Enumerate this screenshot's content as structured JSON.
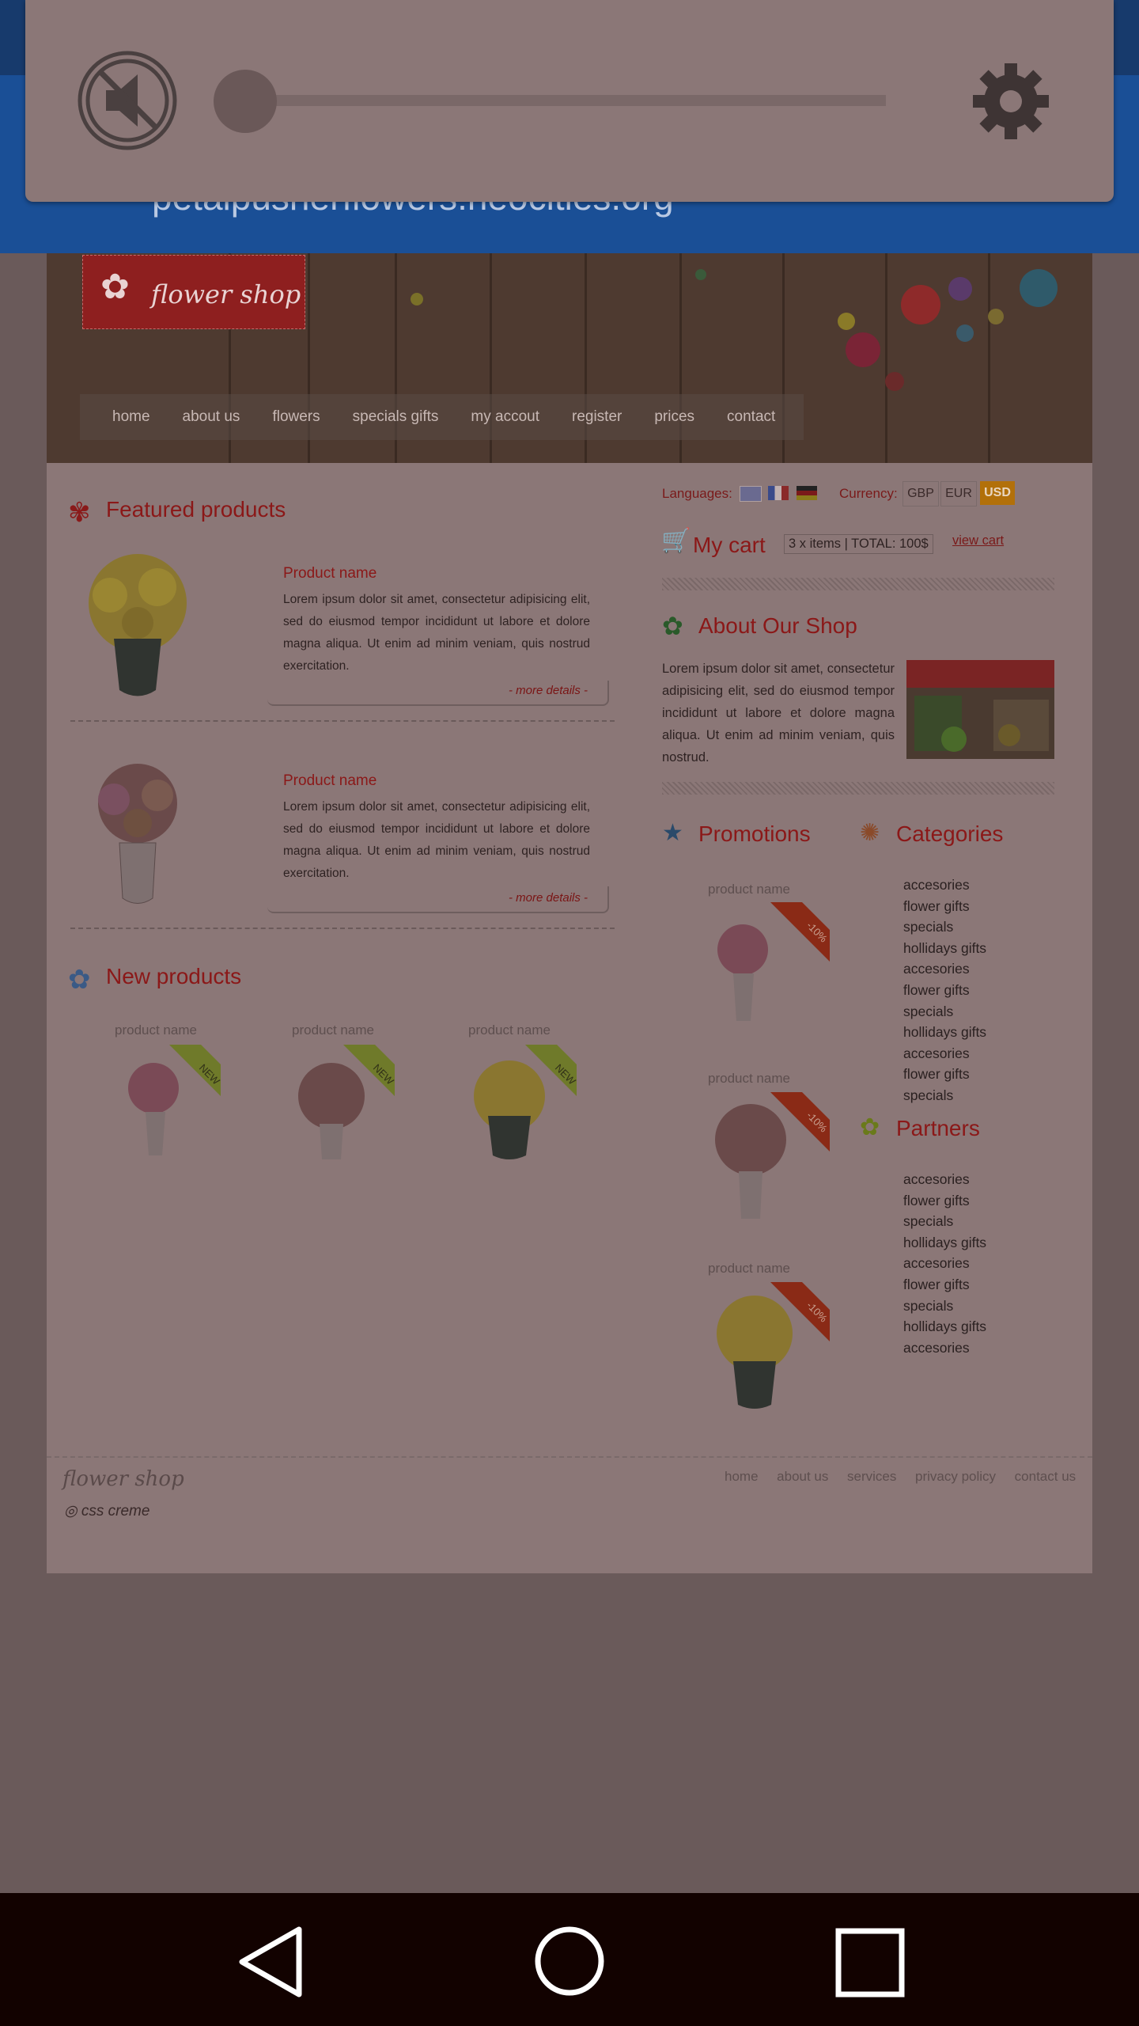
{
  "browser": {
    "url": "petalpusherflowers.neocities.org"
  },
  "media_dialog": {
    "mute_icon": "volume-muted-icon",
    "settings_icon": "gear-icon",
    "volume_level": 0.0
  },
  "site": {
    "logo_text": "flower shop",
    "nav": [
      "home",
      "about us",
      "flowers",
      "specials gifts",
      "my accout",
      "register",
      "prices",
      "contact"
    ]
  },
  "featured": {
    "title": "Featured products",
    "items": [
      {
        "name": "Product name",
        "text": "Lorem ipsum dolor sit amet, consectetur adipisicing elit, sed do eiusmod tempor incididunt ut labore et dolore magna aliqua. Ut enim ad minim veniam, quis nostrud exercitation.",
        "more": "- more details -"
      },
      {
        "name": "Product name",
        "text": "Lorem ipsum dolor sit amet, consectetur adipisicing elit, sed do eiusmod tempor incididunt ut labore et dolore magna aliqua. Ut enim ad minim veniam, quis nostrud exercitation.",
        "more": "- more details -"
      }
    ]
  },
  "new_products": {
    "title": "New products",
    "items": [
      {
        "name": "product name",
        "badge": "NEW"
      },
      {
        "name": "product name",
        "badge": "NEW"
      },
      {
        "name": "product name",
        "badge": "NEW"
      }
    ]
  },
  "settings": {
    "languages_label": "Languages:",
    "currency_label": "Currency:",
    "currencies": [
      "GBP",
      "EUR",
      "USD"
    ],
    "selected_currency": "USD"
  },
  "cart": {
    "title": "My cart",
    "summary": "3 x items | TOTAL: 100$",
    "view": "view cart"
  },
  "about": {
    "title": "About Our Shop",
    "text": "Lorem ipsum dolor sit amet, consectetur adipisicing elit, sed do eiusmod tempor incididunt ut labore et dolore magna aliqua. Ut enim ad minim veniam, quis nostrud."
  },
  "promotions": {
    "title": "Promotions",
    "items": [
      {
        "name": "product name",
        "badge": "-10%"
      },
      {
        "name": "product name",
        "badge": "-10%"
      },
      {
        "name": "product name",
        "badge": "-10%"
      }
    ]
  },
  "categories": {
    "title": "Categories",
    "items": [
      "accesories",
      "flower gifts",
      "specials",
      "hollidays gifts",
      "accesories",
      "flower gifts",
      "specials",
      "hollidays gifts",
      "accesories",
      "flower gifts",
      "specials"
    ]
  },
  "partners": {
    "title": "Partners",
    "items": [
      "accesories",
      "flower gifts",
      "specials",
      "hollidays gifts",
      "accesories",
      "flower gifts",
      "specials",
      "hollidays gifts",
      "accesories"
    ]
  },
  "footer": {
    "logo_text": "flower shop",
    "credit": "css creme",
    "links": [
      "home",
      "about us",
      "services",
      "privacy policy",
      "contact us"
    ]
  },
  "android_nav": {
    "back_icon": "back-icon",
    "home_icon": "home-icon",
    "recents_icon": "recents-icon"
  }
}
